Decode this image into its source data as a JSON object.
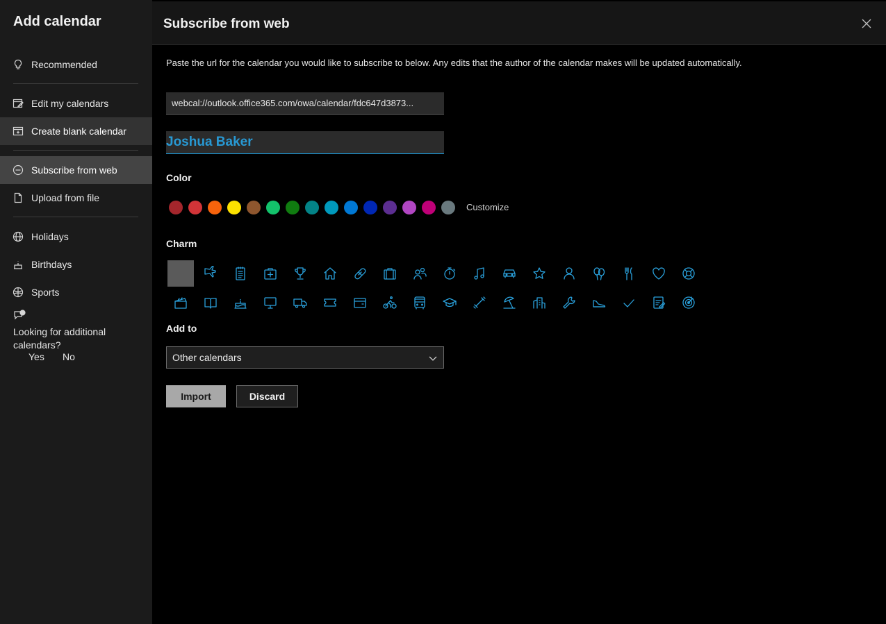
{
  "sidebar": {
    "title": "Add calendar",
    "items": [
      {
        "label": "Recommended",
        "icon": "lightbulb-icon"
      },
      {
        "label": "Edit my calendars",
        "icon": "edit-calendar-icon"
      },
      {
        "label": "Create blank calendar",
        "icon": "add-calendar-icon"
      },
      {
        "label": "Subscribe from web",
        "icon": "globe-link-icon"
      },
      {
        "label": "Upload from file",
        "icon": "file-icon"
      },
      {
        "label": "Holidays",
        "icon": "globe-icon"
      },
      {
        "label": "Birthdays",
        "icon": "cake-icon"
      },
      {
        "label": "Sports",
        "icon": "ball-icon"
      }
    ],
    "feedback": {
      "question": "Looking for additional calendars?",
      "yes": "Yes",
      "no": "No"
    }
  },
  "main": {
    "title": "Subscribe from web",
    "description": "Paste the url for the calendar you would like to subscribe to below. Any edits that the author of the calendar makes will be updated automatically.",
    "url_value": "webcal://outlook.office365.com/owa/calendar/fdc647d3873...",
    "name_value": "Joshua Baker",
    "color_label": "Color",
    "colors": [
      "#a4262c",
      "#d13438",
      "#f7630c",
      "#fce100",
      "#8e562e",
      "#13c26b",
      "#107c10",
      "#038387",
      "#0099bc",
      "#0078d4",
      "#0027b4",
      "#5c2e91",
      "#b146c2",
      "#bf0077",
      "#69797e"
    ],
    "customize_label": "Customize",
    "charm_label": "Charm",
    "charms_row1": [
      "none",
      "airplane-icon",
      "notepad-icon",
      "medical-bag-icon",
      "trophy-icon",
      "home-icon",
      "bandage-icon",
      "briefcase-icon",
      "people-icon",
      "stopwatch-icon",
      "music-note-icon",
      "car-icon",
      "star-icon",
      "person-icon",
      "balloons-icon",
      "fork-knife-icon",
      "heart-icon",
      "lifebuoy-icon"
    ],
    "charms_row2": [
      "clapperboard-icon",
      "book-icon",
      "birthday-cake-icon",
      "monitor-icon",
      "truck-icon",
      "ticket-icon",
      "wallet-icon",
      "cyclist-icon",
      "bus-icon",
      "graduation-cap-icon",
      "dumbbell-icon",
      "beach-icon",
      "city-icon",
      "wrench-icon",
      "sneaker-icon",
      "checkmark-icon",
      "task-list-icon",
      "target-icon"
    ],
    "add_to_label": "Add to",
    "add_to_value": "Other calendars",
    "import_label": "Import",
    "discard_label": "Discard"
  }
}
